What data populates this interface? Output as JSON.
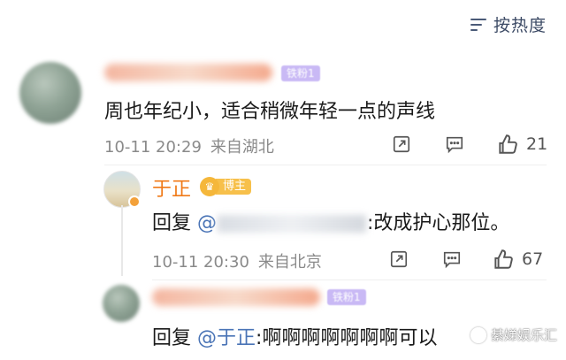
{
  "sort": {
    "label": "按热度",
    "icon": "sort-lines-icon",
    "color": "#3b4964"
  },
  "comment1": {
    "text": "周也年纪小，适合稍微年轻一点的声线",
    "fan_badge": "铁粉1",
    "time": "10-11 20:29",
    "location": "来自湖北",
    "likes": "21"
  },
  "reply1": {
    "username": "于正",
    "badge": "博主",
    "prefix": "回复",
    "mention_at": "@",
    "text_suffix": ":改成护心那位。",
    "time": "10-11 20:30",
    "location": "来自北京",
    "likes": "67"
  },
  "reply2": {
    "fan_badge": "铁粉1",
    "prefix": "回复",
    "mention": "@于正",
    "text_suffix": ":啊啊啊啊啊啊啊可以"
  },
  "watermark": {
    "text": "綦娣娱乐汇"
  },
  "colors": {
    "username": "#f07a18",
    "mention": "#4a74b6",
    "meta": "#8a8a8a",
    "badge": "#f7c04b"
  }
}
